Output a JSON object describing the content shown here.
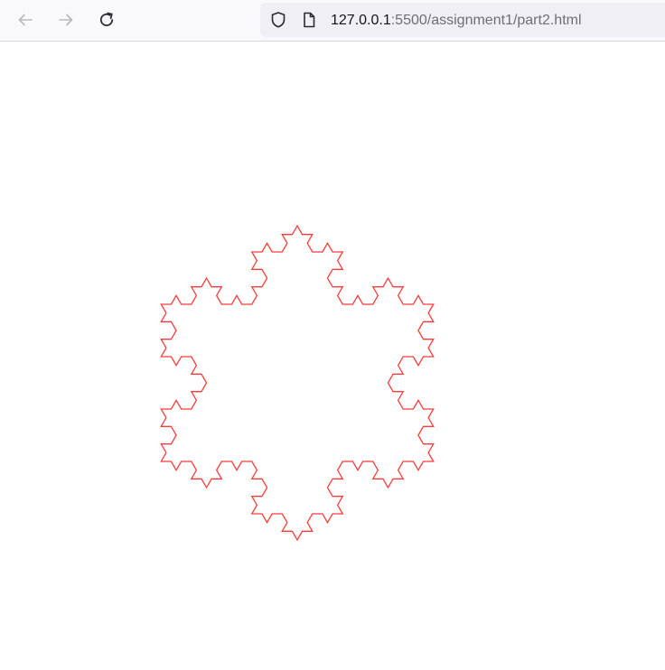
{
  "browser": {
    "nav": {
      "back_icon": "arrow-left-icon",
      "forward_icon": "arrow-right-icon",
      "reload_icon": "reload-icon"
    },
    "urlbar": {
      "shield_icon": "shield-icon",
      "page_icon": "page-icon",
      "url_host": "127.0.0.1",
      "url_rest": ":5500/assignment1/part2.html"
    }
  },
  "page": {
    "figure": "koch-snowflake",
    "stroke_color": "#ff3b3b",
    "recursion_depth": 3
  }
}
